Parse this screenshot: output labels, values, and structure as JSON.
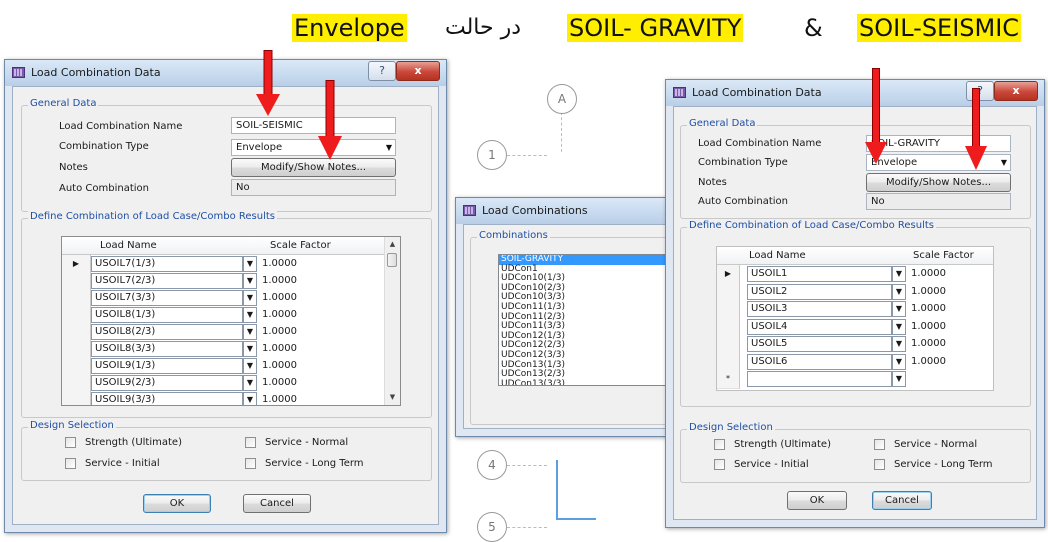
{
  "heading": {
    "term_envelope": "Envelope",
    "text_state": "در حالت",
    "term_gravity": "SOIL- GRAVITY",
    "ampersand": "&",
    "term_seismic": "SOIL-SEISMIC",
    "highlight_color": "#ffee00"
  },
  "cad": {
    "grid_bubbles": [
      "A",
      "1",
      "4",
      "5"
    ]
  },
  "left_dialog": {
    "title": "Load Combination Data",
    "help_label": "?",
    "close_label": "x",
    "general_data": {
      "group_title": "General Data",
      "name_label": "Load Combination Name",
      "name_value": "SOIL-SEISMIC",
      "type_label": "Combination Type",
      "type_value": "Envelope",
      "notes_label": "Notes",
      "notes_button": "Modify/Show Notes...",
      "auto_label": "Auto Combination",
      "auto_value": "No"
    },
    "define_group_title": "Define Combination of Load Case/Combo Results",
    "grid": {
      "col_load_name": "Load Name",
      "col_scale_factor": "Scale Factor",
      "rows": [
        {
          "marker": "▶",
          "name": "USOIL7(1/3)",
          "scale": "1.0000"
        },
        {
          "marker": "",
          "name": "USOIL7(2/3)",
          "scale": "1.0000"
        },
        {
          "marker": "",
          "name": "USOIL7(3/3)",
          "scale": "1.0000"
        },
        {
          "marker": "",
          "name": "USOIL8(1/3)",
          "scale": "1.0000"
        },
        {
          "marker": "",
          "name": "USOIL8(2/3)",
          "scale": "1.0000"
        },
        {
          "marker": "",
          "name": "USOIL8(3/3)",
          "scale": "1.0000"
        },
        {
          "marker": "",
          "name": "USOIL9(1/3)",
          "scale": "1.0000"
        },
        {
          "marker": "",
          "name": "USOIL9(2/3)",
          "scale": "1.0000"
        },
        {
          "marker": "",
          "name": "USOIL9(3/3)",
          "scale": "1.0000"
        }
      ]
    },
    "design": {
      "group_title": "Design Selection",
      "strength": "Strength (Ultimate)",
      "service_normal": "Service - Normal",
      "service_initial": "Service - Initial",
      "service_long": "Service - Long Term"
    },
    "ok_label": "OK",
    "cancel_label": "Cancel"
  },
  "middle_dialog": {
    "title": "Load Combinations",
    "group_title": "Combinations",
    "items": [
      "SOIL-GRAVITY",
      "UDCon1",
      "UDCon10(1/3)",
      "UDCon10(2/3)",
      "UDCon10(3/3)",
      "UDCon11(1/3)",
      "UDCon11(2/3)",
      "UDCon11(3/3)",
      "UDCon12(1/3)",
      "UDCon12(2/3)",
      "UDCon12(3/3)",
      "UDCon13(1/3)",
      "UDCon13(2/3)",
      "UDCon13(3/3)"
    ],
    "selected_index": 0
  },
  "right_dialog": {
    "title": "Load Combination Data",
    "help_label": "?",
    "close_label": "x",
    "general_data": {
      "group_title": "General Data",
      "name_label": "Load Combination Name",
      "name_value": "SOIL-GRAVITY",
      "type_label": "Combination Type",
      "type_value": "Envelope",
      "notes_label": "Notes",
      "notes_button": "Modify/Show Notes...",
      "auto_label": "Auto Combination",
      "auto_value": "No"
    },
    "define_group_title": "Define Combination of Load Case/Combo Results",
    "grid": {
      "col_load_name": "Load Name",
      "col_scale_factor": "Scale Factor",
      "rows": [
        {
          "marker": "▶",
          "name": "USOIL1",
          "scale": "1.0000"
        },
        {
          "marker": "",
          "name": "USOIL2",
          "scale": "1.0000"
        },
        {
          "marker": "",
          "name": "USOIL3",
          "scale": "1.0000"
        },
        {
          "marker": "",
          "name": "USOIL4",
          "scale": "1.0000"
        },
        {
          "marker": "",
          "name": "USOIL5",
          "scale": "1.0000"
        },
        {
          "marker": "",
          "name": "USOIL6",
          "scale": "1.0000"
        },
        {
          "marker": "*",
          "name": "",
          "scale": ""
        }
      ]
    },
    "design": {
      "group_title": "Design Selection",
      "strength": "Strength (Ultimate)",
      "service_normal": "Service - Normal",
      "service_initial": "Service - Initial",
      "service_long": "Service - Long Term"
    },
    "ok_label": "OK",
    "cancel_label": "Cancel"
  },
  "colors": {
    "arrow": "#ee1c1c",
    "group_title": "#1f4fa5",
    "selection": "#3399ff"
  }
}
